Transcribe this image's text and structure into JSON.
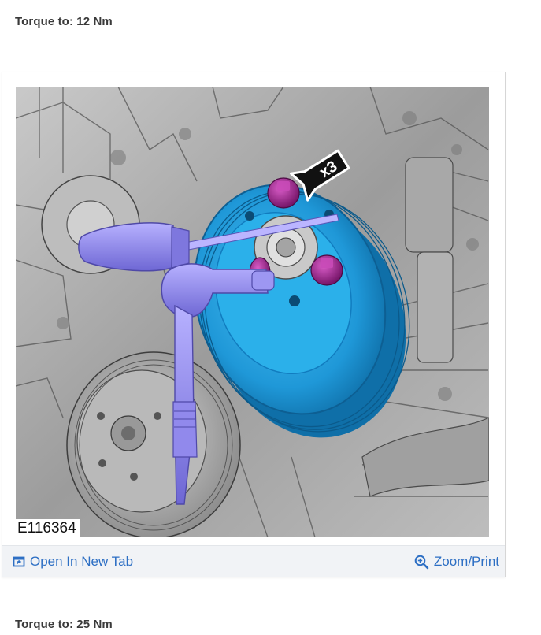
{
  "steps": [
    {
      "torque_text": "Torque to: 12 Nm"
    },
    {
      "torque_text": "Torque to: 25 Nm"
    }
  ],
  "figure": {
    "id_label": "E116364",
    "callout_label": "x3",
    "colors": {
      "pulley": "#2aa9e6",
      "tool": "#8c84e8",
      "bolt": "#9b1f8a",
      "engine": "#b4b4b4",
      "toolbar_bg": "#f1f3f6",
      "link": "#2d6fc4"
    }
  },
  "toolbar": {
    "open_tab_label": "Open In New Tab",
    "open_tab_icon": "open-new-tab-icon",
    "zoom_label": "Zoom/Print",
    "zoom_icon": "zoom-in-icon"
  }
}
